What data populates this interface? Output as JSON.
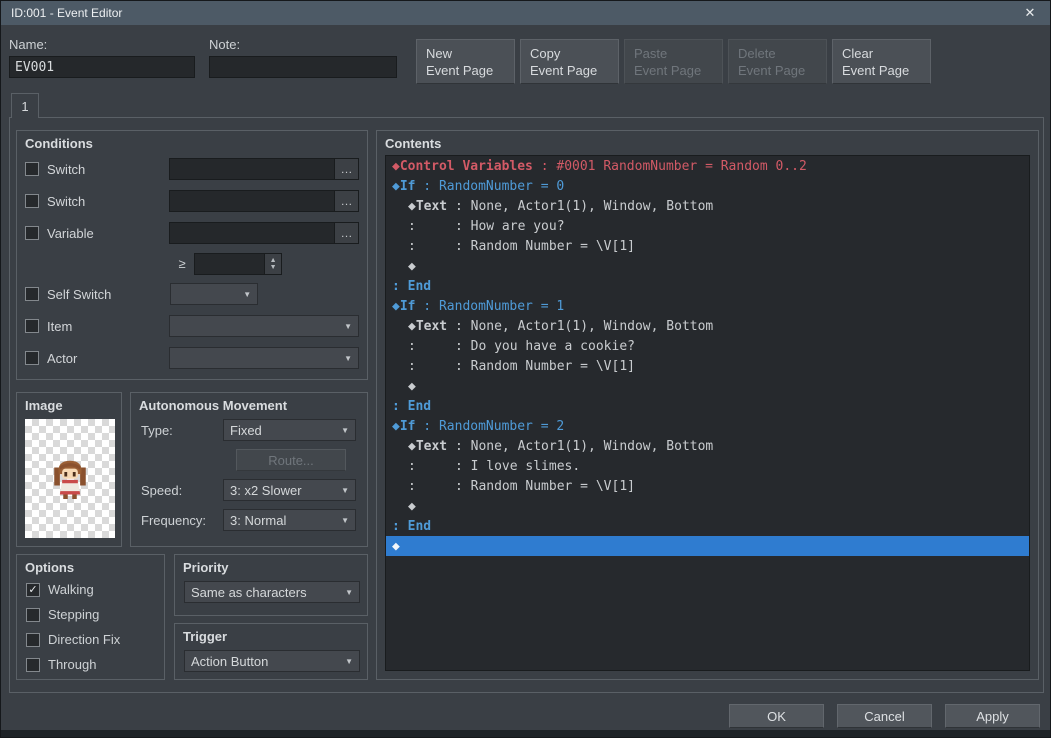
{
  "window": {
    "title": "ID:001 - Event Editor",
    "close_icon": "✕"
  },
  "colors": {
    "titlebar": "#4d5a66",
    "dialog_bg": "#3a3f45",
    "panel_border": "#5a6066",
    "input_bg": "#25282b",
    "button_bg": "#4b5056",
    "text": "#d2d5d8",
    "disabled_text": "#70767c",
    "list_bg": "#26292d",
    "cmd_variable": "#d25a66",
    "cmd_flow": "#4f9bd8",
    "cmd_text": "#c9cccf",
    "selection": "#2f7cd0"
  },
  "header": {
    "name": {
      "label": "Name:",
      "value": "EV001"
    },
    "note": {
      "label": "Note:",
      "value": ""
    },
    "page_buttons": [
      {
        "line1": "New",
        "line2": "Event Page",
        "enabled": true
      },
      {
        "line1": "Copy",
        "line2": "Event Page",
        "enabled": true
      },
      {
        "line1": "Paste",
        "line2": "Event Page",
        "enabled": false
      },
      {
        "line1": "Delete",
        "line2": "Event Page",
        "enabled": false
      },
      {
        "line1": "Clear",
        "line2": "Event Page",
        "enabled": true
      }
    ]
  },
  "tab": {
    "label": "1"
  },
  "conditions": {
    "title": "Conditions",
    "switch1_label": "Switch",
    "switch1_value": "",
    "switch2_label": "Switch",
    "switch2_value": "",
    "variable_label": "Variable",
    "variable_value": "",
    "operator": "≥",
    "threshold_value": "",
    "self_switch_label": "Self Switch",
    "self_switch_value": "",
    "item_label": "Item",
    "item_value": "",
    "actor_label": "Actor",
    "actor_value": "",
    "more_icon": "…",
    "arrow_icon": "▼",
    "spin_up_icon": "▲",
    "spin_down_icon": "▼"
  },
  "image": {
    "title": "Image"
  },
  "movement": {
    "title": "Autonomous Movement",
    "type_label": "Type:",
    "type_value": "Fixed",
    "route_label": "Route...",
    "speed_label": "Speed:",
    "speed_value": "3: x2 Slower",
    "frequency_label": "Frequency:",
    "frequency_value": "3: Normal"
  },
  "options": {
    "title": "Options",
    "items": [
      {
        "label": "Walking",
        "checked": true
      },
      {
        "label": "Stepping",
        "checked": false
      },
      {
        "label": "Direction Fix",
        "checked": false
      },
      {
        "label": "Through",
        "checked": false
      }
    ]
  },
  "priority": {
    "title": "Priority",
    "value": "Same as characters"
  },
  "trigger": {
    "title": "Trigger",
    "value": "Action Button"
  },
  "contents": {
    "title": "Contents",
    "lines": [
      {
        "bold": "◆Control Variables",
        "text": " : #0001 RandomNumber = Random 0..2",
        "color": "variable",
        "indent": 0,
        "selected": false
      },
      {
        "bold": "◆If",
        "text": " : RandomNumber = 0",
        "color": "flow",
        "indent": 0,
        "selected": false
      },
      {
        "bold": "◆Text",
        "text": " : None, Actor1(1), Window, Bottom",
        "color": "normal",
        "indent": 1,
        "selected": false
      },
      {
        "bold": "",
        "text": ":     : How are you?",
        "color": "normal",
        "indent": 1,
        "selected": false
      },
      {
        "bold": "",
        "text": ":     : Random Number = \\V[1]",
        "color": "normal",
        "indent": 1,
        "selected": false
      },
      {
        "bold": "",
        "text": "◆",
        "color": "normal",
        "indent": 1,
        "selected": false
      },
      {
        "bold": ": End",
        "text": "",
        "color": "flow",
        "indent": 0,
        "selected": false
      },
      {
        "bold": "◆If",
        "text": " : RandomNumber = 1",
        "color": "flow",
        "indent": 0,
        "selected": false
      },
      {
        "bold": "◆Text",
        "text": " : None, Actor1(1), Window, Bottom",
        "color": "normal",
        "indent": 1,
        "selected": false
      },
      {
        "bold": "",
        "text": ":     : Do you have a cookie?",
        "color": "normal",
        "indent": 1,
        "selected": false
      },
      {
        "bold": "",
        "text": ":     : Random Number = \\V[1]",
        "color": "normal",
        "indent": 1,
        "selected": false
      },
      {
        "bold": "",
        "text": "◆",
        "color": "normal",
        "indent": 1,
        "selected": false
      },
      {
        "bold": ": End",
        "text": "",
        "color": "flow",
        "indent": 0,
        "selected": false
      },
      {
        "bold": "◆If",
        "text": " : RandomNumber = 2",
        "color": "flow",
        "indent": 0,
        "selected": false
      },
      {
        "bold": "◆Text",
        "text": " : None, Actor1(1), Window, Bottom",
        "color": "normal",
        "indent": 1,
        "selected": false
      },
      {
        "bold": "",
        "text": ":     : I love slimes.",
        "color": "normal",
        "indent": 1,
        "selected": false
      },
      {
        "bold": "",
        "text": ":     : Random Number = \\V[1]",
        "color": "normal",
        "indent": 1,
        "selected": false
      },
      {
        "bold": "",
        "text": "◆",
        "color": "normal",
        "indent": 1,
        "selected": false
      },
      {
        "bold": ": End",
        "text": "",
        "color": "flow",
        "indent": 0,
        "selected": false
      },
      {
        "bold": "",
        "text": "◆",
        "color": "normal",
        "indent": 0,
        "selected": true
      }
    ]
  },
  "footer": {
    "ok": "OK",
    "cancel": "Cancel",
    "apply": "Apply"
  }
}
